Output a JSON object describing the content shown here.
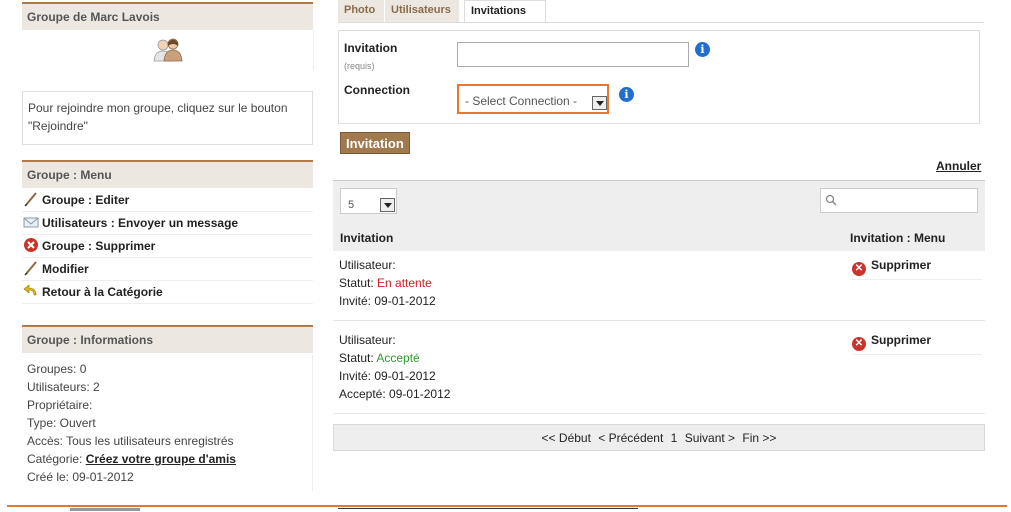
{
  "sidebar": {
    "group_title": "Groupe de Marc Lavois",
    "join_text": "Pour rejoindre mon groupe, cliquez sur le bouton \"Rejoindre\"",
    "menu_title": "Groupe : Menu",
    "menu_items": [
      {
        "label": "Groupe : Editer",
        "icon": "pencil-icon"
      },
      {
        "label": "Utilisateurs : Envoyer un message",
        "icon": "envelope-icon"
      },
      {
        "label": "Groupe : Supprimer",
        "icon": "delete-icon"
      },
      {
        "label": "Modifier",
        "icon": "pencil-icon"
      },
      {
        "label": "Retour à la Catégorie",
        "icon": "return-arrow-icon"
      }
    ],
    "info_title": "Groupe : Informations",
    "info": {
      "groupes": "Groupes: 0",
      "utilisateurs": "Utilisateurs: 2",
      "proprietaire": "Propriétaire:",
      "type": "Type: Ouvert",
      "acces": "Accès: Tous les utilisateurs enregistrés",
      "categorie_label": "Catégorie:",
      "categorie_link": "Créez votre groupe d'amis",
      "cree": "Créé le: 09-01-2012"
    }
  },
  "tabs": [
    {
      "label": "Photo",
      "active": false
    },
    {
      "label": "Utilisateurs",
      "active": false
    },
    {
      "label": "Invitations",
      "active": true
    }
  ],
  "form": {
    "invitation_label": "Invitation",
    "invitation_required": "(requis)",
    "invitation_value": "",
    "connection_label": "Connection",
    "connection_selected": "- Select Connection -",
    "info_glyph": "i",
    "submit_label": "Invitation",
    "cancel_label": "Annuler"
  },
  "table": {
    "per_page": "5",
    "search_placeholder": "",
    "col_invitation": "Invitation",
    "col_menu": "Invitation : Menu",
    "rows": [
      {
        "user": "Utilisateur:",
        "status_label": "Statut:",
        "status_value": "En attente",
        "invited": "Invité: 09-01-2012",
        "action": "Supprimer"
      },
      {
        "user": "Utilisateur:",
        "status_label": "Statut:",
        "status_value": "Accepté",
        "invited": "Invité: 09-01-2012",
        "accepted": "Accepté: 09-01-2012",
        "action": "Supprimer"
      }
    ],
    "pager": {
      "first": "<< Début",
      "prev": "< Précédent",
      "page": "1",
      "next": "Suivant >",
      "last": "Fin >>"
    }
  },
  "colors": {
    "accent": "#b07a49",
    "pending": "#cc2222",
    "accepted": "#2e9a2e",
    "footer_line": "#e8772e"
  }
}
